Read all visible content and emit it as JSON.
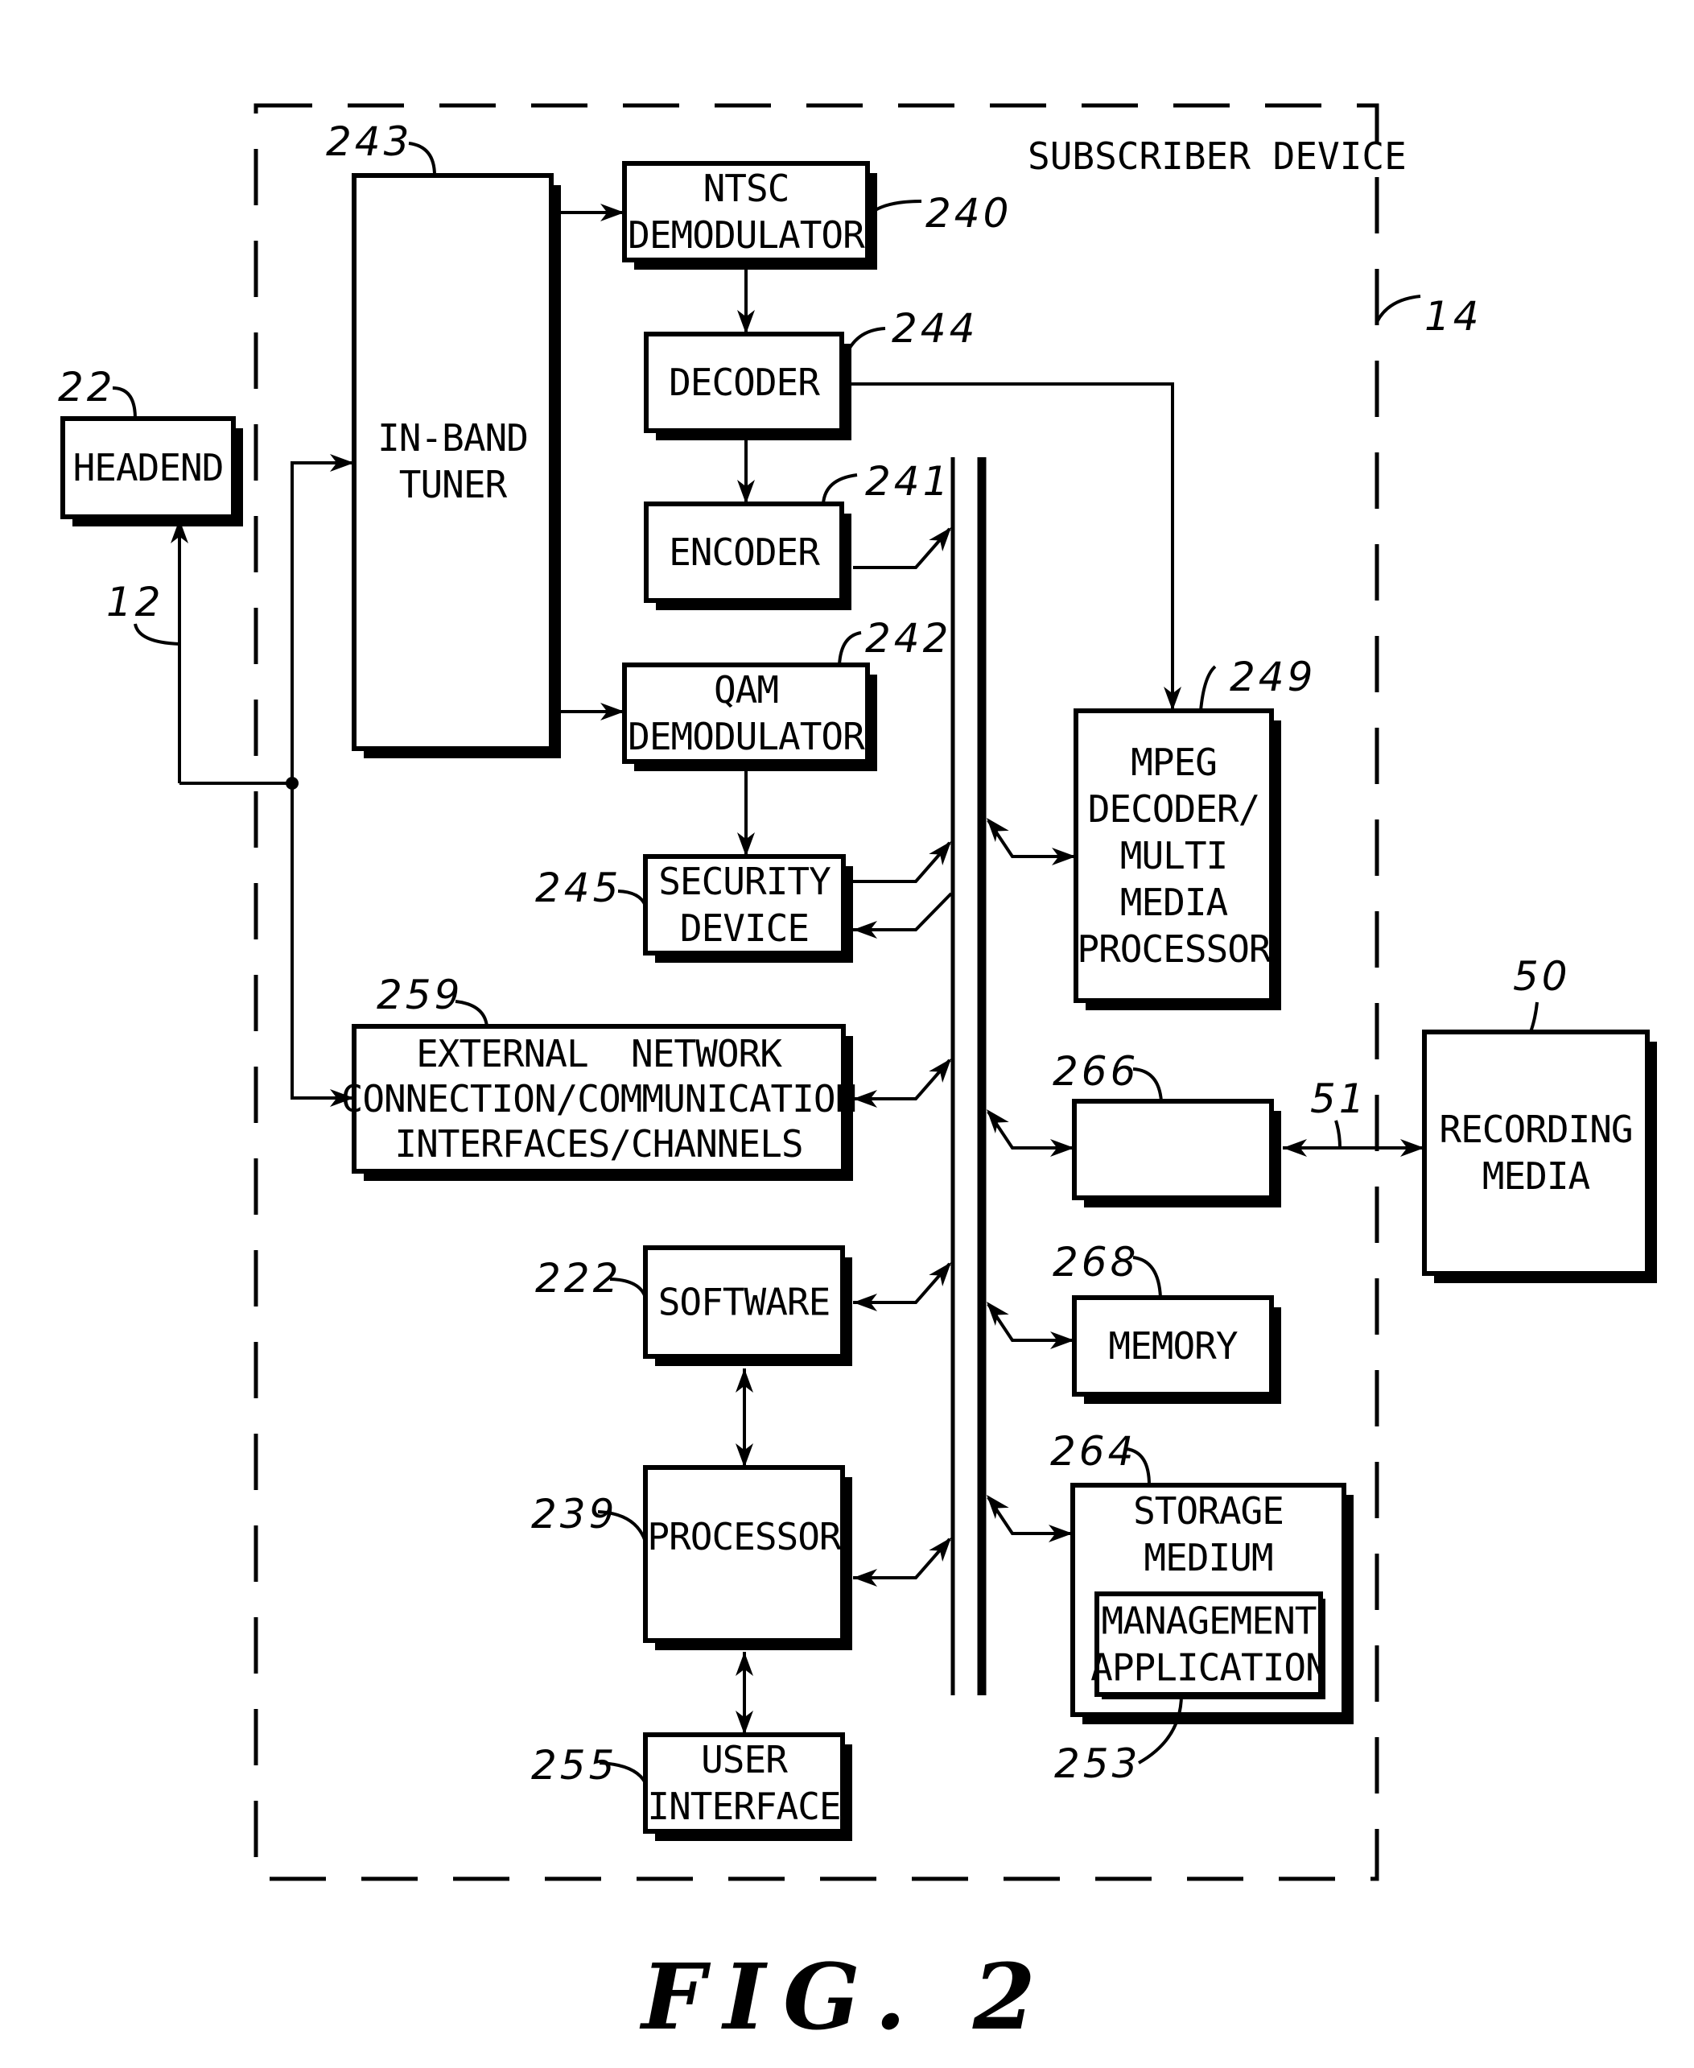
{
  "figure": {
    "caption": "FIG. 2",
    "container_title": "SUBSCRIBER DEVICE",
    "container_ref": "14"
  },
  "blocks": {
    "headend": {
      "lines": [
        "HEADEND"
      ],
      "ref": "22"
    },
    "tuner": {
      "lines": [
        "IN-BAND",
        "TUNER"
      ],
      "ref": "243"
    },
    "ntsc": {
      "lines": [
        "NTSC",
        "DEMODULATOR"
      ],
      "ref": "240"
    },
    "decoder": {
      "lines": [
        "DECODER"
      ],
      "ref": "244"
    },
    "encoder": {
      "lines": [
        "ENCODER"
      ],
      "ref": "241"
    },
    "qam": {
      "lines": [
        "QAM",
        "DEMODULATOR"
      ],
      "ref": "242"
    },
    "security": {
      "lines": [
        "SECURITY",
        "DEVICE"
      ],
      "ref": "245"
    },
    "extnet": {
      "lines": [
        "EXTERNAL  NETWORK",
        "CONNECTION/COMMUNICATION",
        "INTERFACES/CHANNELS"
      ],
      "ref": "259"
    },
    "software": {
      "lines": [
        "SOFTWARE"
      ],
      "ref": "222"
    },
    "processor": {
      "lines": [
        "PROCESSOR"
      ],
      "ref": "239"
    },
    "ui": {
      "lines": [
        "USER",
        "INTERFACE"
      ],
      "ref": "255"
    },
    "mpeg": {
      "lines": [
        "MPEG",
        "DECODER/",
        "MULTI",
        "MEDIA",
        "PROCESSOR"
      ],
      "ref": "249"
    },
    "box266": {
      "lines": [],
      "ref": "266"
    },
    "memory": {
      "lines": [
        "MEMORY"
      ],
      "ref": "268"
    },
    "storage": {
      "lines": [
        "STORAGE",
        "MEDIUM"
      ],
      "ref": "264"
    },
    "mgmt": {
      "lines": [
        "MANAGEMENT",
        "APPLICATION"
      ],
      "ref": "253"
    },
    "recording": {
      "lines": [
        "RECORDING",
        "MEDIA"
      ],
      "ref": "50"
    }
  },
  "connections": {
    "network_ref": "12",
    "recording_link_ref": "51"
  }
}
